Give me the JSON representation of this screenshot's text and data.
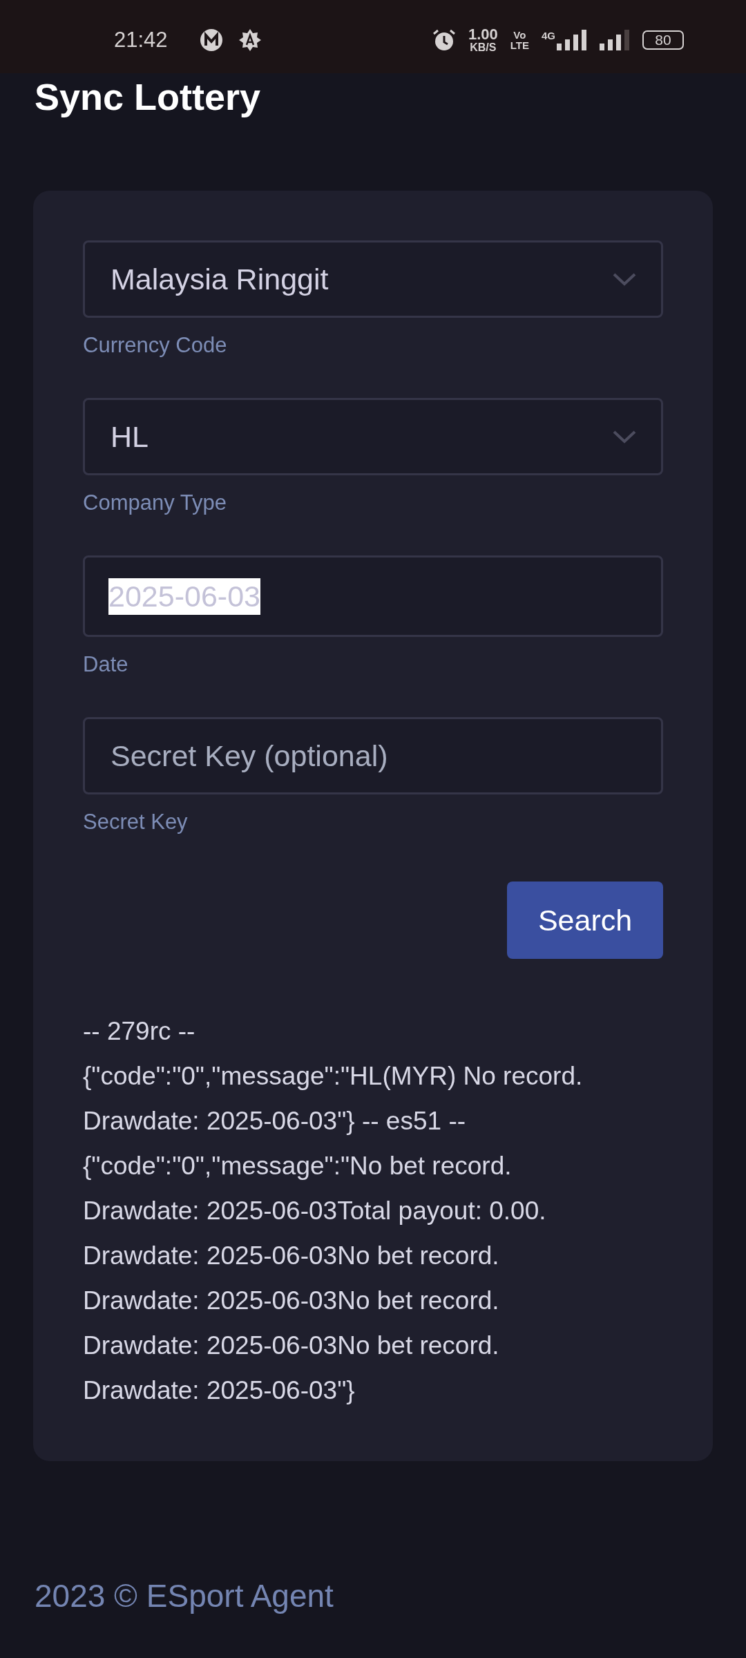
{
  "status_bar": {
    "time": "21:42",
    "net_speed": "1.00",
    "net_unit": "KB/S",
    "volte_top": "Vo",
    "volte_bottom": "LTE",
    "network": "4G",
    "battery": "80"
  },
  "page_title": "Sync Lottery",
  "form": {
    "fields": [
      {
        "kind": "select",
        "value": "Malaysia Ringgit",
        "label": "Currency Code"
      },
      {
        "kind": "select",
        "value": "HL",
        "label": "Company Type"
      },
      {
        "kind": "date",
        "value": "2025-06-03",
        "highlighted": true,
        "label": "Date"
      },
      {
        "kind": "text",
        "placeholder": "Secret Key (optional)",
        "label": "Secret Key"
      }
    ],
    "button": "Search"
  },
  "result_lines": [
    "-- 279rc --",
    "{\"code\":\"0\",\"message\":\"HL(MYR) No record.",
    "Drawdate: 2025-06-03\"} -- es51 --",
    "{\"code\":\"0\",\"message\":\"No bet record.",
    "Drawdate: 2025-06-03Total payout: 0.00.",
    "Drawdate: 2025-06-03No bet record.",
    "Drawdate: 2025-06-03No bet record.",
    "Drawdate: 2025-06-03No bet record.",
    "Drawdate: 2025-06-03\"}"
  ],
  "footer": "2023 © ESport Agent"
}
